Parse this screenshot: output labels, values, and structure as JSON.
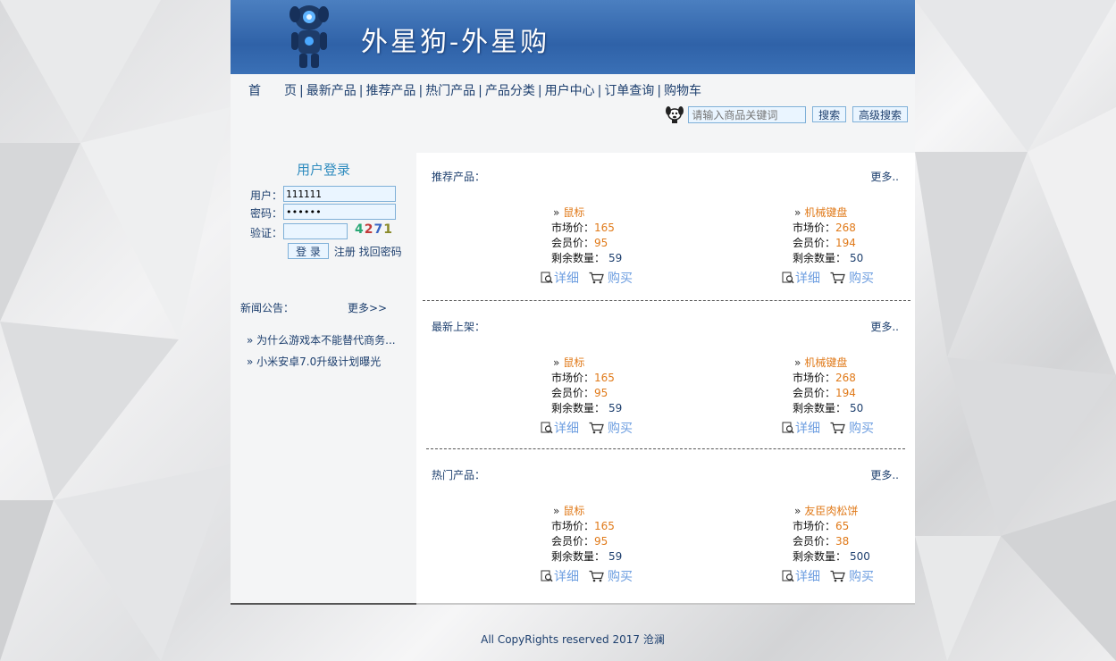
{
  "site": {
    "title": "外星狗-外星购"
  },
  "nav": {
    "items": [
      {
        "label": "首  页"
      },
      {
        "label": "最新产品"
      },
      {
        "label": "推荐产品"
      },
      {
        "label": "热门产品"
      },
      {
        "label": "产品分类"
      },
      {
        "label": "用户中心"
      },
      {
        "label": "订单查询"
      },
      {
        "label": "购物车"
      }
    ],
    "separator": "|"
  },
  "search": {
    "placeholder": "请输入商品关键词",
    "search_label": "搜索",
    "advanced_label": "高级搜索"
  },
  "login": {
    "title": "用户登录",
    "user_label": "用户：",
    "user_value": "111111",
    "password_label": "密码：",
    "password_value": "••••••",
    "captcha_label": "验证：",
    "captcha_value": "",
    "captcha_chars": [
      "4",
      "2",
      "7",
      "1"
    ],
    "login_button": "登 录",
    "register_link": "注册",
    "recover_link": "找回密码"
  },
  "news": {
    "title": "新闻公告：",
    "more": "更多>>",
    "items": [
      {
        "label": "为什么游戏本不能替代商务..."
      },
      {
        "label": "小米安卓7.0升级计划曝光"
      }
    ]
  },
  "labels": {
    "market_price": "市场价：",
    "member_price": "会员价：",
    "stock": "剩余数量：",
    "detail": "详细",
    "buy": "购买",
    "more": "更多.."
  },
  "sections": [
    {
      "title": "推荐产品：",
      "products": [
        {
          "name": "鼠标",
          "market": "165",
          "member": "95",
          "stock": "59",
          "image": "mouse"
        },
        {
          "name": "机械键盘",
          "market": "268",
          "member": "194",
          "stock": "50",
          "image": "keyboard"
        }
      ]
    },
    {
      "title": "最新上架：",
      "products": [
        {
          "name": "鼠标",
          "market": "165",
          "member": "95",
          "stock": "59",
          "image": "mouse"
        },
        {
          "name": "机械键盘",
          "market": "268",
          "member": "194",
          "stock": "50",
          "image": "keyboard"
        }
      ]
    },
    {
      "title": "热门产品：",
      "products": [
        {
          "name": "鼠标",
          "market": "165",
          "member": "95",
          "stock": "59",
          "image": "mouse"
        },
        {
          "name": "友臣肉松饼",
          "market": "65",
          "member": "38",
          "stock": "500",
          "image": "snack-box"
        }
      ]
    }
  ],
  "footer": {
    "text": "All CopyRights reserved 2017 沧澜"
  },
  "colors": {
    "banner": "#3a70b6",
    "link": "#1d3f6e",
    "price": "#e07a1a",
    "action": "#6d9ee0"
  }
}
